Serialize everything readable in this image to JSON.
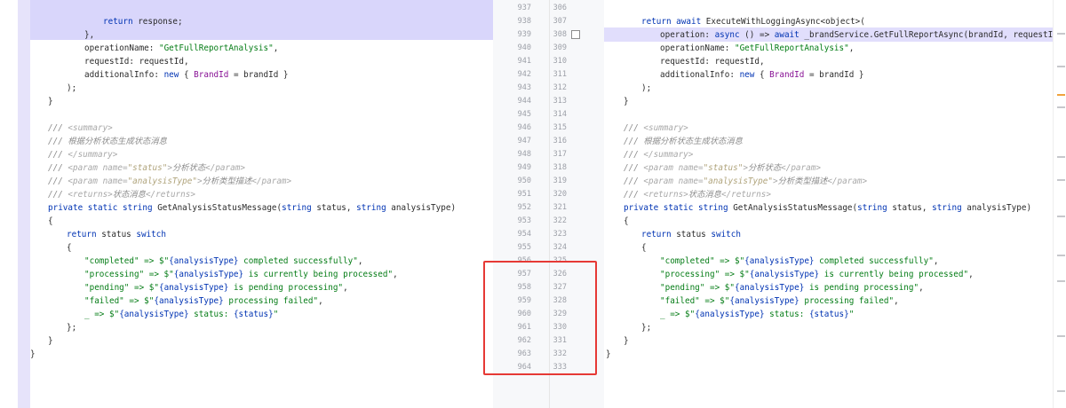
{
  "gutter": {
    "left_numbers": [
      "937",
      "938",
      "939",
      "940",
      "941",
      "942",
      "943",
      "944",
      "945",
      "946",
      "947",
      "948",
      "949",
      "950",
      "951",
      "952",
      "953",
      "954",
      "955",
      "956",
      "957",
      "958",
      "959",
      "960",
      "961",
      "962",
      "963",
      "964"
    ],
    "right_numbers": [
      "306",
      "307",
      "308",
      "309",
      "310",
      "311",
      "312",
      "313",
      "314",
      "315",
      "316",
      "317",
      "318",
      "319",
      "320",
      "321",
      "322",
      "323",
      "324",
      "325",
      "326",
      "327",
      "328",
      "329",
      "330",
      "331",
      "332",
      "333"
    ]
  },
  "left_code": {
    "l0_ret": "return",
    "l0_rest": " response;",
    "l1": "},",
    "l2_a": "operationName: ",
    "l2_s": "\"GetFullReportAnalysis\"",
    "l2_b": ",",
    "l3": "requestId: requestId,",
    "l4_a": "additionalInfo: ",
    "l4_new": "new",
    "l4_b": " { ",
    "l4_prop": "BrandId",
    "l4_c": " = brandId }",
    "l5": ");",
    "l6": "}",
    "d1_a": "/// ",
    "d1_t": "<summary>",
    "d2": "/// 根据分析状态生成状态消息",
    "d3_a": "/// ",
    "d3_t": "</summary>",
    "d4_a": "/// ",
    "d4_t1": "<param name=",
    "d4_v": "\"status\"",
    "d4_t2": ">",
    "d4_txt": "分析状态",
    "d4_t3": "</param>",
    "d5_a": "/// ",
    "d5_t1": "<param name=",
    "d5_v": "\"analysisType\"",
    "d5_t2": ">",
    "d5_txt": "分析类型描述",
    "d5_t3": "</param>",
    "d6_a": "/// ",
    "d6_t1": "<returns>",
    "d6_txt": "状态消息",
    "d6_t2": "</returns>",
    "m_kw1": "private",
    "m_kw2": "static",
    "m_kw3": "string",
    "m_name": " GetAnalysisStatusMessage(",
    "m_kw4": "string",
    "m_p1": " status, ",
    "m_kw5": "string",
    "m_p2": " analysisType)",
    "b_open": "{",
    "r_kw": "return",
    "r_mid": " status ",
    "r_sw": "switch",
    "s_open": "{",
    "c1_s": "\"completed\"",
    "c1_a": " => $\"",
    "c1_i": "{analysisType}",
    "c1_t": " completed successfully\"",
    "c1_e": ",",
    "c2_s": "\"processing\"",
    "c2_a": " => $\"",
    "c2_i": "{analysisType}",
    "c2_t": " is currently being processed\"",
    "c2_e": ",",
    "c3_s": "\"pending\"",
    "c3_a": " => $\"",
    "c3_i": "{analysisType}",
    "c3_t": " is pending processing\"",
    "c3_e": ",",
    "c4_s": "\"failed\"",
    "c4_a": " => $\"",
    "c4_i": "{analysisType}",
    "c4_t": " processing failed\"",
    "c4_e": ",",
    "c5_a": "_ => $\"",
    "c5_i": "{analysisType}",
    "c5_t": " status: ",
    "c5_i2": "{status}",
    "c5_e": "\"",
    "s_close": "};",
    "b_close": "}",
    "cls_close": "}"
  },
  "right_code": {
    "r1_ret": "return await",
    "r1_rest": " ExecuteWithLoggingAsync<object>(",
    "r2_a": "operation: ",
    "r2_kw": "async",
    "r2_b": " () => ",
    "r2_kw2": "await",
    "r2_c": " _brandService.GetFullReportAsync(brandId, requestId),",
    "r3_a": "operationName: ",
    "r3_s": "\"GetFullReportAnalysis\"",
    "r3_b": ",",
    "r4": "requestId: requestId,",
    "r5_a": "additionalInfo: ",
    "r5_new": "new",
    "r5_b": " { ",
    "r5_prop": "BrandId",
    "r5_c": " = brandId }",
    "r6": ");",
    "r7": "}",
    "d1_a": "/// ",
    "d1_t": "<summary>",
    "d2": "/// 根据分析状态生成状态消息",
    "d3_a": "/// ",
    "d3_t": "</summary>",
    "d4_a": "/// ",
    "d4_t1": "<param name=",
    "d4_v": "\"status\"",
    "d4_t2": ">",
    "d4_txt": "分析状态",
    "d4_t3": "</param>",
    "d5_a": "/// ",
    "d5_t1": "<param name=",
    "d5_v": "\"analysisType\"",
    "d5_t2": ">",
    "d5_txt": "分析类型描述",
    "d5_t3": "</param>",
    "d6_a": "/// ",
    "d6_t1": "<returns>",
    "d6_txt": "状态消息",
    "d6_t2": "</returns>",
    "m_kw1": "private",
    "m_kw2": "static",
    "m_kw3": "string",
    "m_name": " GetAnalysisStatusMessage(",
    "m_kw4": "string",
    "m_p1": " status, ",
    "m_kw5": "string",
    "m_p2": " analysisType)",
    "b_open": "{",
    "r_kw": "return",
    "r_mid": " status ",
    "r_sw": "switch",
    "s_open": "{",
    "c1_s": "\"completed\"",
    "c1_a": " => $\"",
    "c1_i": "{analysisType}",
    "c1_t": " completed successfully\"",
    "c1_e": ",",
    "c2_s": "\"processing\"",
    "c2_a": " => $\"",
    "c2_i": "{analysisType}",
    "c2_t": " is currently being processed\"",
    "c2_e": ",",
    "c3_s": "\"pending\"",
    "c3_a": " => $\"",
    "c3_i": "{analysisType}",
    "c3_t": " is pending processing\"",
    "c3_e": ",",
    "c4_s": "\"failed\"",
    "c4_a": " => $\"",
    "c4_i": "{analysisType}",
    "c4_t": " processing failed\"",
    "c4_e": ",",
    "c5_a": "_ => $\"",
    "c5_i": "{analysisType}",
    "c5_t": " status: ",
    "c5_i2": "{status}",
    "c5_e": "\"",
    "s_close": "};",
    "b_close": "}",
    "cls_close": "}"
  },
  "colors": {
    "annotation_box": "#e63935",
    "changed_block_bg": "#d9d6fb",
    "gutter_bg": "#f7f8fa"
  }
}
